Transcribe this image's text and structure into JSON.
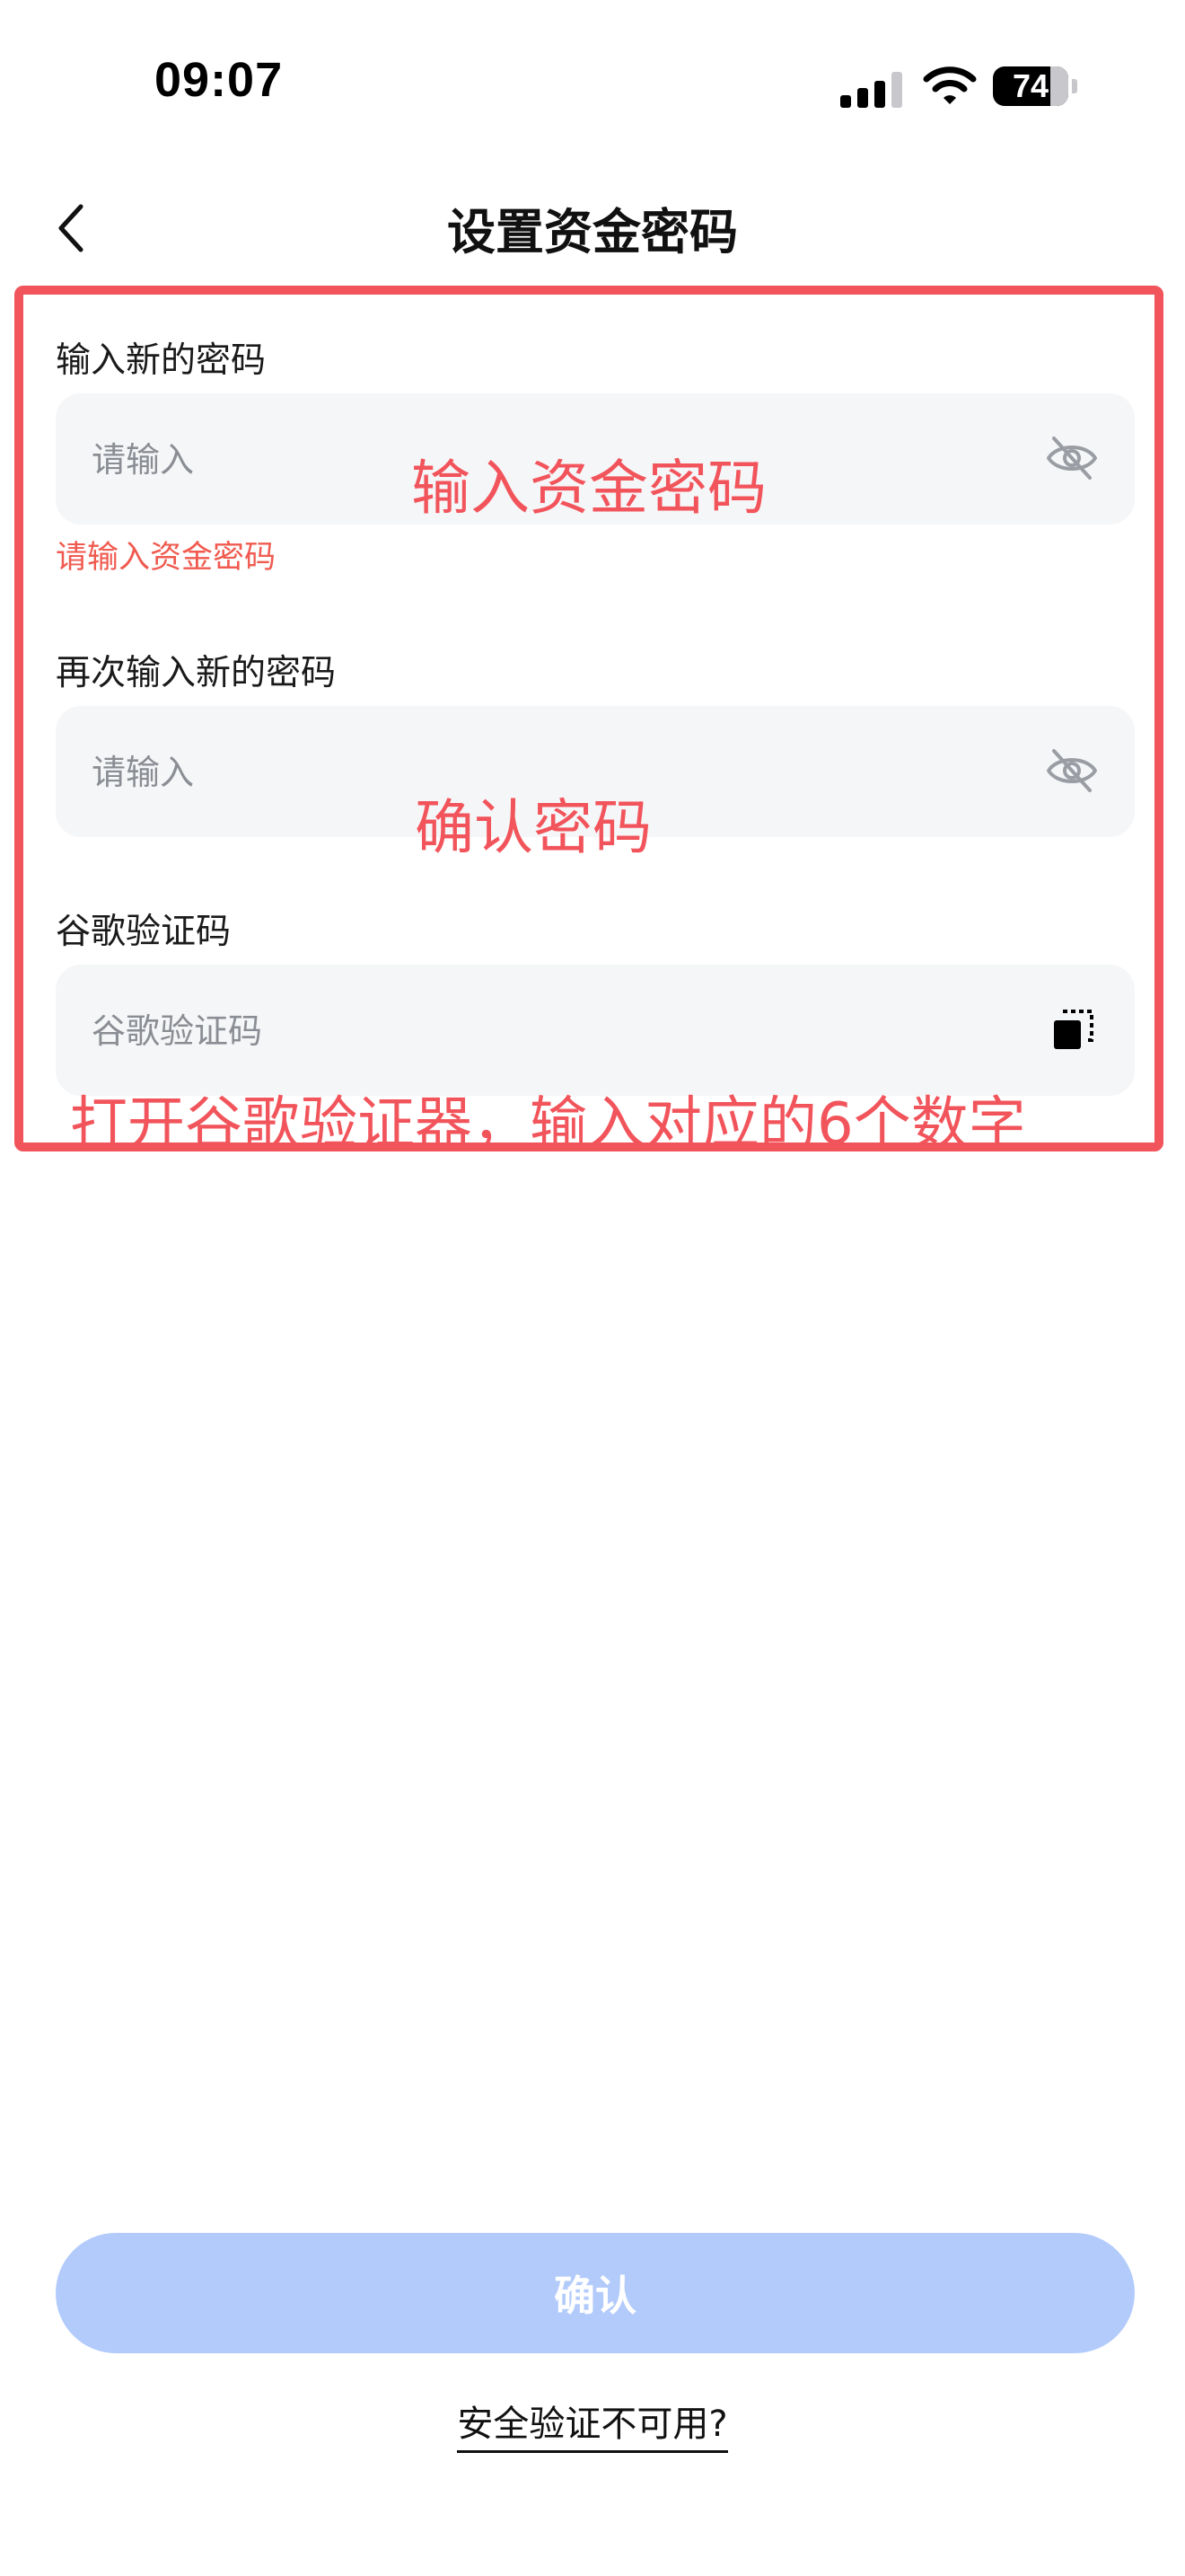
{
  "status_bar": {
    "time": "09:07",
    "battery": "74"
  },
  "header": {
    "title": "设置资金密码"
  },
  "form": {
    "new_password": {
      "label": "输入新的密码",
      "placeholder": "请输入",
      "error": "请输入资金密码"
    },
    "confirm_password": {
      "label": "再次输入新的密码",
      "placeholder": "请输入"
    },
    "google_code": {
      "label": "谷歌验证码",
      "placeholder": "谷歌验证码"
    }
  },
  "annotations": {
    "password_hint": "输入资金密码",
    "confirm_hint": "确认密码",
    "google_hint": "打开谷歌验证器，输入对应的6个数字"
  },
  "footer": {
    "confirm_label": "确认",
    "unavailable_label": "安全验证不可用?"
  },
  "colors": {
    "annotation_red": "#f2545b",
    "error_red": "#f05a4f",
    "button_disabled_blue": "#b2cbfb",
    "field_bg": "#f5f6f8"
  }
}
